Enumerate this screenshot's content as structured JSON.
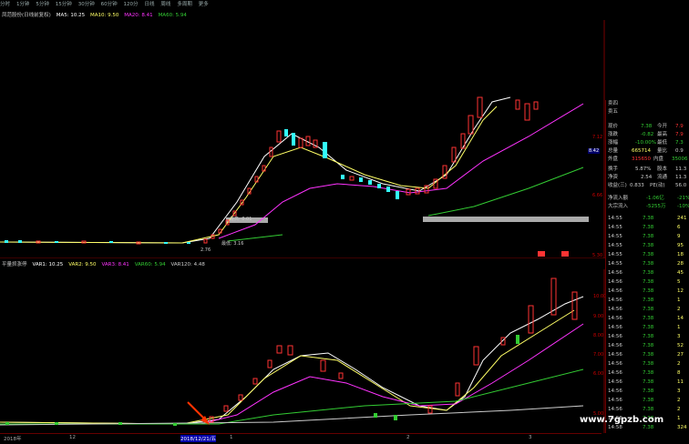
{
  "toolbar": {
    "items": [
      "分时",
      "1分钟",
      "5分钟",
      "15分钟",
      "30分钟",
      "60分钟",
      "120分",
      "日线",
      "周线",
      "多周期",
      "更多"
    ]
  },
  "main_chart": {
    "title": "凤范股份(日线前复权)",
    "ma5": "MA5: 10.25",
    "ma10": "MA10: 9.50",
    "ma20": "MA20: 8.41",
    "ma60": "MA60: 5.94",
    "price_box_labels": [
      "最高: 8.01",
      "最低: 3.16"
    ],
    "low_label": "2.76",
    "right_price_tag": "8.42",
    "y_labels": [
      "7.12",
      "6.66",
      "5.30"
    ]
  },
  "sub_chart": {
    "title": "平量抓涨停",
    "var1": "VAR1: 10.25",
    "var2": "VAR2: 9.50",
    "var3": "VAR3: 8.41",
    "var60": "VAR60: 5.94",
    "var120": "VAR120: 4.48",
    "y_labels": [
      "10.00",
      "9.00",
      "8.00",
      "7.00",
      "6.00",
      "5.00"
    ]
  },
  "x_axis": {
    "labels": [
      "2018年",
      "12",
      "2018/12/21/五",
      "1",
      "2",
      "3"
    ]
  },
  "quote_panel": {
    "sell_rows": [
      {
        "label": "卖四",
        "price": "",
        "vol": ""
      },
      {
        "label": "卖五",
        "price": "",
        "vol": ""
      }
    ],
    "stats": [
      {
        "l1": "现价",
        "v1": "7.38",
        "l2": "今开",
        "v2": "7.9"
      },
      {
        "l1": "涨跌",
        "v1": "-0.82",
        "l2": "最高",
        "v2": "7.9"
      },
      {
        "l1": "涨幅",
        "v1": "-10.00%",
        "l2": "最低",
        "v2": "7.3"
      },
      {
        "l1": "总量",
        "v1": "665714",
        "l2": "量比",
        "v2": "0.9"
      },
      {
        "l1": "外盘",
        "v1": "315650",
        "l2": "内盘",
        "v2": "35006"
      },
      {
        "l1": "换手",
        "v1": "5.87%",
        "l2": "股本",
        "v2": "11.3"
      },
      {
        "l1": "净资",
        "v1": "2.54",
        "l2": "流通",
        "v2": "11.3"
      },
      {
        "l1": "收益(三)",
        "v1": "0.833",
        "l2": "PE(动)",
        "v2": "56.0"
      }
    ],
    "flows": [
      {
        "label": "净流入额",
        "value": "-1.06亿",
        "pct": "-21%"
      },
      {
        "label": "大宗流入",
        "value": "-5255万",
        "pct": "-10%"
      }
    ],
    "ticks": [
      {
        "time": "14:55",
        "price": "7.38",
        "vol": "241"
      },
      {
        "time": "14:55",
        "price": "7.38",
        "vol": "6"
      },
      {
        "time": "14:55",
        "price": "7.38",
        "vol": "9"
      },
      {
        "time": "14:55",
        "price": "7.38",
        "vol": "95"
      },
      {
        "time": "14:55",
        "price": "7.38",
        "vol": "18"
      },
      {
        "time": "14:55",
        "price": "7.38",
        "vol": "28"
      },
      {
        "time": "14:56",
        "price": "7.38",
        "vol": "45"
      },
      {
        "time": "14:56",
        "price": "7.38",
        "vol": "5"
      },
      {
        "time": "14:56",
        "price": "7.38",
        "vol": "12"
      },
      {
        "time": "14:56",
        "price": "7.38",
        "vol": "1"
      },
      {
        "time": "14:56",
        "price": "7.38",
        "vol": "2"
      },
      {
        "time": "14:56",
        "price": "7.38",
        "vol": "14"
      },
      {
        "time": "14:56",
        "price": "7.38",
        "vol": "1"
      },
      {
        "time": "14:56",
        "price": "7.38",
        "vol": "3"
      },
      {
        "time": "14:56",
        "price": "7.38",
        "vol": "52"
      },
      {
        "time": "14:56",
        "price": "7.38",
        "vol": "27"
      },
      {
        "time": "14:56",
        "price": "7.38",
        "vol": "2"
      },
      {
        "time": "14:56",
        "price": "7.38",
        "vol": "8"
      },
      {
        "time": "14:56",
        "price": "7.38",
        "vol": "11"
      },
      {
        "time": "14:56",
        "price": "7.38",
        "vol": "3"
      },
      {
        "time": "14:56",
        "price": "7.38",
        "vol": "2"
      },
      {
        "time": "14:56",
        "price": "7.38",
        "vol": "2"
      },
      {
        "time": "14:56",
        "price": "7.38",
        "vol": "1"
      },
      {
        "time": "14:58",
        "price": "7.38",
        "vol": "324"
      }
    ]
  },
  "watermark": "www.7gpzb.com",
  "colors": {
    "bg": "#000000",
    "up": "#ff3333",
    "down": "#33ffff",
    "ma5": "#ffffff",
    "ma10": "#ffff66",
    "ma20": "#ff33ff",
    "ma60": "#33cc33",
    "arrow": "#ff3300"
  }
}
